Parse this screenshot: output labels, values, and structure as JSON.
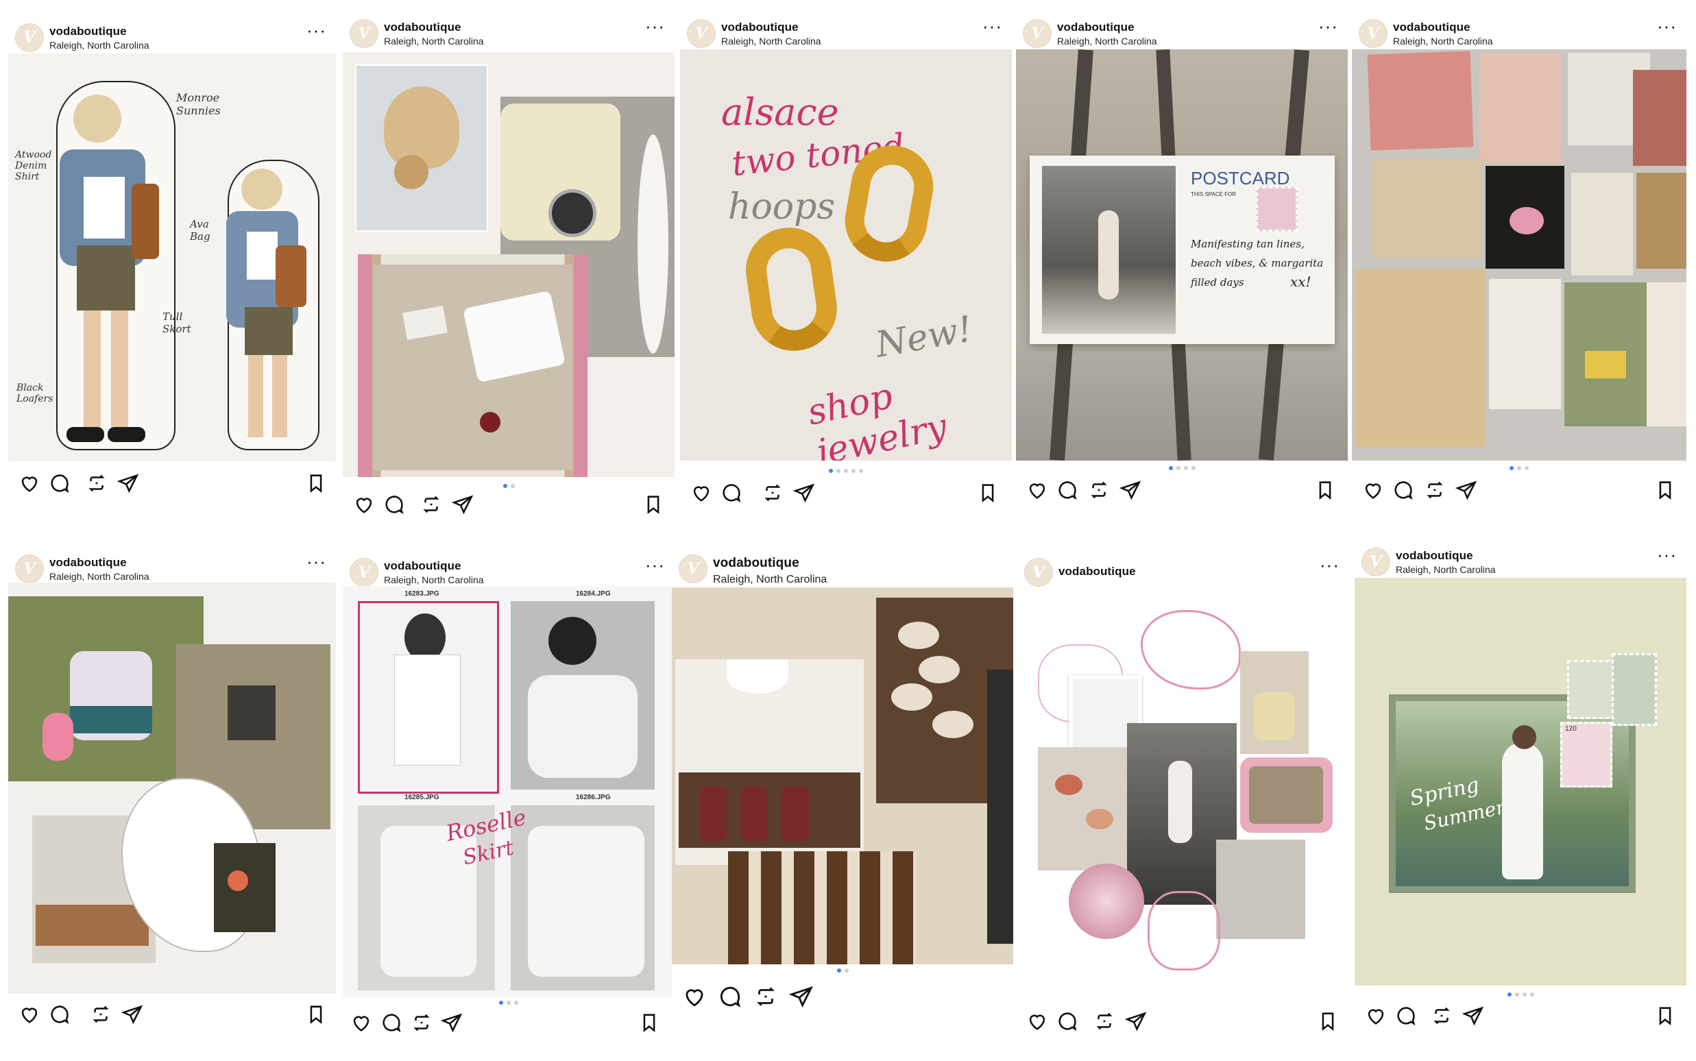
{
  "account": {
    "username": "vodaboutique",
    "location": "Raleigh, North Carolina",
    "avatar_letter": "V",
    "more_label": "•••"
  },
  "posts": [
    {
      "username": "vodaboutique",
      "location": "Raleigh, North Carolina",
      "dots": 0,
      "active_dot": 0,
      "annotations": [
        "Monroe Sunnies",
        "Atwood Denim Shirt",
        "Ava Bag",
        "Tull Skort",
        "Black Loafers"
      ]
    },
    {
      "username": "vodaboutique",
      "location": "Raleigh, North Carolina",
      "dots": 2,
      "active_dot": 0
    },
    {
      "username": "vodaboutique",
      "location": "Raleigh, North Carolina",
      "dots": 5,
      "active_dot": 0,
      "script": {
        "line1": "alsace",
        "line2": "two toned",
        "line3": "hoops",
        "new": "New!",
        "shop": "shop jewelry"
      }
    },
    {
      "username": "vodaboutique",
      "location": "Raleigh, North Carolina",
      "dots": 4,
      "active_dot": 0,
      "postcard": {
        "title": "POSTCARD",
        "subtitle": "THIS SPACE FOR",
        "line1": "Manifesting tan lines,",
        "line2": "beach vibes, & margarita",
        "line3": "filled days",
        "sign": "xx!"
      }
    },
    {
      "username": "vodaboutique",
      "location": "Raleigh, North Carolina",
      "dots": 3,
      "active_dot": 0
    },
    {
      "username": "vodaboutique",
      "location": "Raleigh, North Carolina",
      "dots": 0,
      "active_dot": 0
    },
    {
      "username": "vodaboutique",
      "location": "Raleigh, North Carolina",
      "dots": 3,
      "active_dot": 0,
      "files": [
        "16283.JPG",
        "16284.JPG",
        "16285.JPG",
        "16286.JPG"
      ],
      "script": {
        "line1": "Roselle",
        "line2": "Skirt"
      }
    },
    {
      "username": "vodaboutique",
      "location": "Raleigh, North Carolina",
      "dots": 2,
      "active_dot": 0
    },
    {
      "username": "vodaboutique",
      "location": "",
      "dots": 0,
      "active_dot": 0
    },
    {
      "username": "vodaboutique",
      "location": "Raleigh, North Carolina",
      "dots": 4,
      "active_dot": 0,
      "script": {
        "line1": "Spring",
        "line2": "Summer"
      },
      "stamps": [
        "120",
        "120"
      ]
    }
  ],
  "icons": {
    "like": "heart-icon",
    "comment": "comment-icon",
    "repost": "repost-icon",
    "share": "send-icon",
    "save": "bookmark-icon"
  },
  "colors": {
    "accent_dot": "#3f82ee",
    "inactive_dot": "#cfcfcf",
    "script_pink": "#c8356b",
    "script_ink": "#3a3a3a"
  }
}
